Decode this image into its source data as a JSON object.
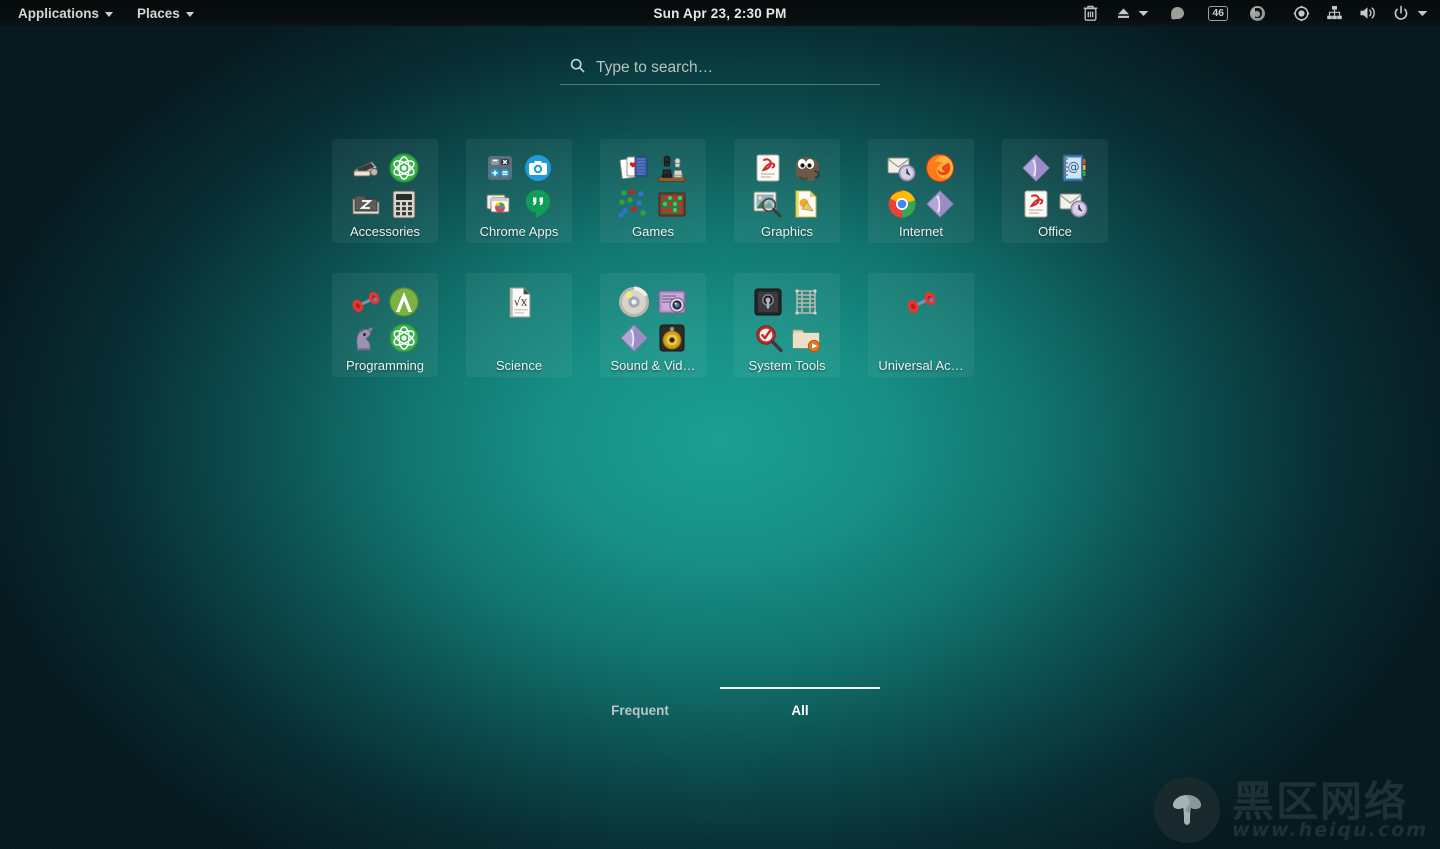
{
  "topbar": {
    "applications_label": "Applications",
    "places_label": "Places",
    "clock": "Sun Apr 23,  2:30 PM",
    "tray": [
      {
        "name": "trash-icon",
        "label": "Trash"
      },
      {
        "name": "eject-icon",
        "label": "Eject"
      },
      {
        "name": "eject-dropdown-icon",
        "label": "Eject menu"
      },
      {
        "name": "chat-bubble-icon",
        "label": "Chat"
      },
      {
        "name": "notification-count-badge",
        "label": "46"
      },
      {
        "name": "chrome-icon",
        "label": "Chrome"
      },
      {
        "name": "record-icon",
        "label": "Recording"
      },
      {
        "name": "network-icon",
        "label": "Network"
      },
      {
        "name": "volume-icon",
        "label": "Volume"
      },
      {
        "name": "power-icon",
        "label": "Power"
      },
      {
        "name": "system-dropdown-icon",
        "label": "System menu"
      }
    ]
  },
  "search": {
    "placeholder": "Type to search…",
    "value": "",
    "icon": "search-icon"
  },
  "app_grid": {
    "folders": [
      {
        "label": "Accessories",
        "icons": [
          "scanner-icon",
          "atom-icon",
          "archive-manager-icon",
          "calculator-icon"
        ]
      },
      {
        "label": "Chrome Apps",
        "icons": [
          "calculator-icon",
          "camera-icon",
          "chrome-windows-icon",
          "hangouts-icon"
        ]
      },
      {
        "label": "Games",
        "icons": [
          "playing-cards-icon",
          "chess-icon",
          "five-or-more-icon",
          "mahjongg-board-icon"
        ]
      },
      {
        "label": "Graphics",
        "icons": [
          "document-viewer-icon",
          "gimp-icon",
          "image-viewer-icon",
          "libreoffice-draw-icon"
        ]
      },
      {
        "label": "Internet",
        "icons": [
          "evolution-mail-icon",
          "firefox-icon",
          "chrome-icon",
          "purple-diamond-icon"
        ]
      },
      {
        "label": "Office",
        "icons": [
          "purple-diamond-icon",
          "address-book-icon",
          "document-viewer-icon",
          "evolution-mail-icon"
        ]
      },
      {
        "label": "Programming",
        "icons": [
          "dfeet-dumbbell-icon",
          "android-studio-icon",
          "gnu-gdb-icon",
          "atom-icon"
        ]
      },
      {
        "label": "Science",
        "icons": [
          "libreoffice-math-icon"
        ]
      },
      {
        "label": "Sound & Vid…",
        "icons": [
          "cd-burner-icon",
          "webcam-icon",
          "purple-diamond-icon",
          "speaker-icon"
        ]
      },
      {
        "label": "System Tools",
        "icons": [
          "password-safe-icon",
          "virtual-machine-icon",
          "system-monitor-icon",
          "file-manager-icon"
        ]
      },
      {
        "label": "Universal Ac…",
        "icons": [
          "dfeet-dumbbell-icon"
        ]
      }
    ]
  },
  "tabs": [
    {
      "label": "Frequent",
      "active": false
    },
    {
      "label": "All",
      "active": true
    }
  ],
  "watermark": {
    "logo": "mushroom-logo-icon",
    "chinese_text": "黑区网络",
    "url_text": "www.heiqu.com"
  },
  "colors": {
    "desktop_center": "#1aa093",
    "desktop_edge": "#05191f",
    "topbar": "#070d0e",
    "tile_bg": "rgba(255,255,255,0.055)",
    "text_primary": "#eef3f1",
    "tab_inactive": "#b9c6c4"
  }
}
